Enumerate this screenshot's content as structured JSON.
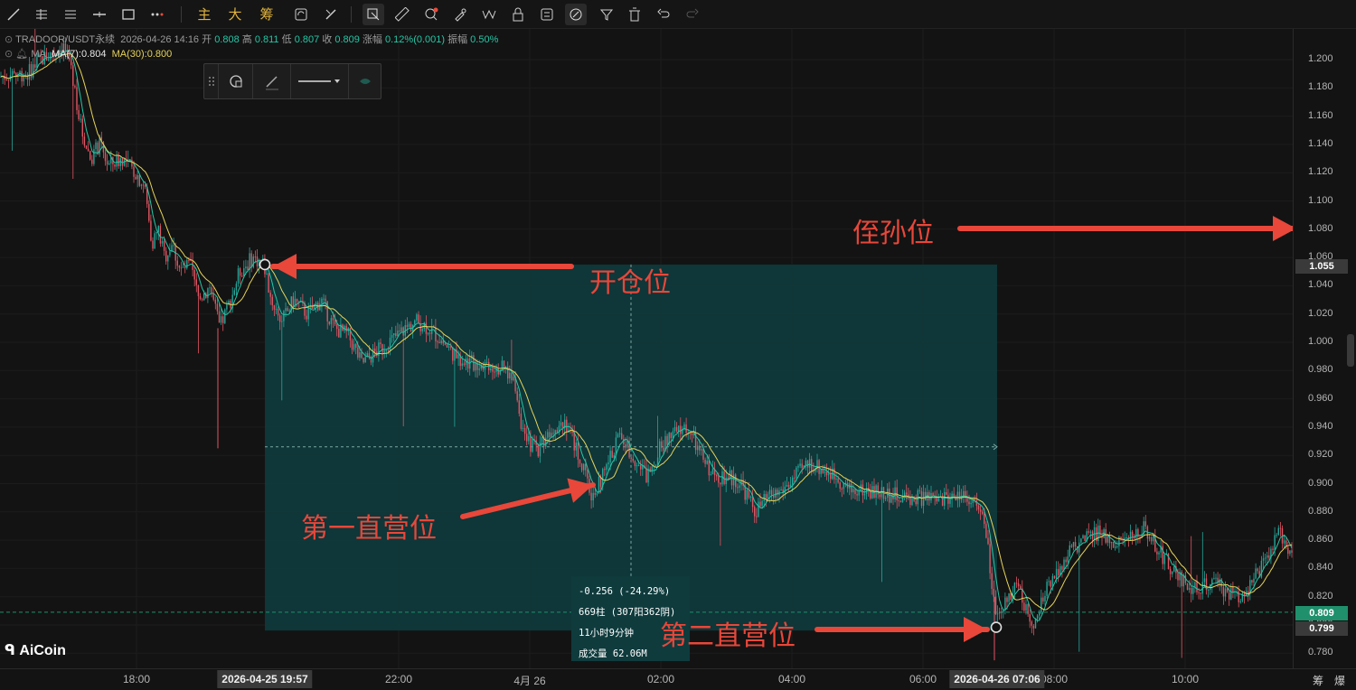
{
  "toolbar": {
    "cn_buttons": [
      "主",
      "大",
      "筹"
    ]
  },
  "info": {
    "symbol": "TRADOOR/USDT永续",
    "datetime": "2026-04-26 14:16",
    "open_label": "开",
    "open": "0.808",
    "high_label": "高",
    "high": "0.811",
    "low_label": "低",
    "low": "0.807",
    "close_label": "收",
    "close": "0.809",
    "change_label": "涨幅",
    "change": "0.12%(0.001)",
    "amp_label": "振幅",
    "amp": "0.50%",
    "ma_label": "MA",
    "ma7": "MA(7):0.804",
    "ma30": "MA(30):0.800"
  },
  "colors": {
    "up": "#26a69a",
    "down": "#e05563",
    "ma7": "#26c6a5",
    "ma30": "#e6d35a",
    "annotation": "#e8473a",
    "measure_fill": "#0f3b3d",
    "badge_green": "#1f8f6c"
  },
  "measure": {
    "line1": "-0.256 (-24.29%)",
    "line2": "669柱 (307阳362阴)",
    "line3": "11小时9分钟",
    "line4": "成交量 62.06M"
  },
  "annotations": {
    "stop": "侄孙位",
    "entry": "开仓位",
    "tp1": "第一直营位",
    "tp2": "第二直营位"
  },
  "y_axis": {
    "ticks": [
      "1.200",
      "1.180",
      "1.160",
      "1.140",
      "1.120",
      "1.100",
      "1.080",
      "1.060",
      "1.040",
      "1.020",
      "1.000",
      "0.980",
      "0.960",
      "0.940",
      "0.920",
      "0.900",
      "0.880",
      "0.860",
      "0.840",
      "0.820",
      "0.800",
      "0.780"
    ],
    "entry_badge": "1.055",
    "current_badge": "0.809",
    "target_badge": "0.799"
  },
  "x_axis": {
    "ticks": [
      "18:00",
      "22:00",
      "4月 26",
      "02:00",
      "04:00",
      "06:00",
      "08:00",
      "10:00"
    ],
    "start_badge": "2026-04-25 19:57",
    "end_badge": "2026-04-26 07:06",
    "right_labels": [
      "筹",
      "爆"
    ]
  },
  "logo": "AiCoin",
  "chart_data": {
    "type": "candlestick",
    "y_range": [
      0.77,
      1.215
    ],
    "measure_start": {
      "time": "2026-04-25 19:57",
      "price": 1.055
    },
    "measure_end": {
      "time": "2026-04-26 07:06",
      "price": 0.799
    },
    "close_path": [
      [
        0,
        1.188
      ],
      [
        15,
        1.19
      ],
      [
        30,
        1.19
      ],
      [
        45,
        1.2
      ],
      [
        60,
        1.205
      ],
      [
        70,
        1.21
      ],
      [
        80,
        1.19
      ],
      [
        90,
        1.15
      ],
      [
        100,
        1.13
      ],
      [
        110,
        1.14
      ],
      [
        120,
        1.125
      ],
      [
        135,
        1.13
      ],
      [
        150,
        1.12
      ],
      [
        160,
        1.11
      ],
      [
        168,
        1.07
      ],
      [
        175,
        1.08
      ],
      [
        182,
        1.06
      ],
      [
        190,
        1.07
      ],
      [
        200,
        1.05
      ],
      [
        210,
        1.055
      ],
      [
        220,
        1.03
      ],
      [
        232,
        1.04
      ],
      [
        243,
        1.01
      ],
      [
        255,
        1.03
      ],
      [
        265,
        1.05
      ],
      [
        280,
        1.06
      ],
      [
        292,
        1.055
      ],
      [
        300,
        1.03
      ],
      [
        312,
        1.015
      ],
      [
        325,
        1.03
      ],
      [
        340,
        1.02
      ],
      [
        355,
        1.03
      ],
      [
        370,
        1.01
      ],
      [
        385,
        1.005
      ],
      [
        400,
        0.985
      ],
      [
        420,
        0.995
      ],
      [
        440,
        1.005
      ],
      [
        460,
        1.015
      ],
      [
        475,
        1.01
      ],
      [
        490,
        1.0
      ],
      [
        505,
        0.99
      ],
      [
        520,
        0.985
      ],
      [
        540,
        0.985
      ],
      [
        560,
        0.98
      ],
      [
        570,
        0.97
      ],
      [
        580,
        0.93
      ],
      [
        595,
        0.925
      ],
      [
        610,
        0.94
      ],
      [
        625,
        0.945
      ],
      [
        640,
        0.92
      ],
      [
        655,
        0.89
      ],
      [
        670,
        0.91
      ],
      [
        685,
        0.935
      ],
      [
        700,
        0.92
      ],
      [
        715,
        0.905
      ],
      [
        730,
        0.925
      ],
      [
        745,
        0.935
      ],
      [
        760,
        0.94
      ],
      [
        775,
        0.92
      ],
      [
        790,
        0.905
      ],
      [
        805,
        0.905
      ],
      [
        820,
        0.9
      ],
      [
        835,
        0.88
      ],
      [
        850,
        0.89
      ],
      [
        865,
        0.895
      ],
      [
        880,
        0.905
      ],
      [
        895,
        0.915
      ],
      [
        910,
        0.91
      ],
      [
        925,
        0.905
      ],
      [
        940,
        0.895
      ],
      [
        960,
        0.895
      ],
      [
        980,
        0.893
      ],
      [
        1000,
        0.89
      ],
      [
        1020,
        0.89
      ],
      [
        1040,
        0.888
      ],
      [
        1060,
        0.893
      ],
      [
        1075,
        0.89
      ],
      [
        1090,
        0.87
      ],
      [
        1102,
        0.8
      ],
      [
        1115,
        0.82
      ],
      [
        1125,
        0.83
      ],
      [
        1135,
        0.81
      ],
      [
        1145,
        0.8
      ],
      [
        1160,
        0.83
      ],
      [
        1175,
        0.845
      ],
      [
        1190,
        0.855
      ],
      [
        1200,
        0.86
      ],
      [
        1215,
        0.865
      ],
      [
        1230,
        0.86
      ],
      [
        1250,
        0.86
      ],
      [
        1265,
        0.87
      ],
      [
        1280,
        0.855
      ],
      [
        1295,
        0.84
      ],
      [
        1310,
        0.83
      ],
      [
        1325,
        0.825
      ],
      [
        1340,
        0.83
      ],
      [
        1355,
        0.825
      ],
      [
        1370,
        0.82
      ],
      [
        1385,
        0.83
      ],
      [
        1400,
        0.845
      ],
      [
        1415,
        0.865
      ],
      [
        1425,
        0.855
      ]
    ]
  }
}
